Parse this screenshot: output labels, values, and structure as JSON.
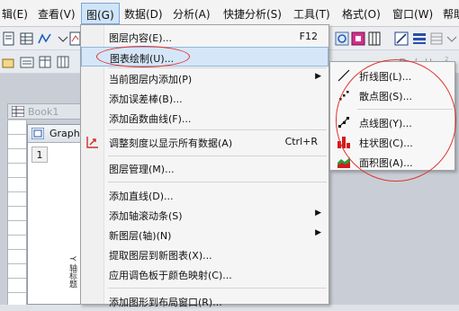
{
  "menubar": {
    "items": [
      "辑(E)",
      "查看(V)",
      "图(G)",
      "数据(D)",
      "分析(A)",
      "快捷分析(S)",
      "工具(T)",
      "格式(O)",
      "窗口(W)",
      "帮助"
    ]
  },
  "workspace": {
    "book_title": "Book1",
    "graph_title": "Graph",
    "layer_number": "1",
    "axis_label": "Y 轴标题"
  },
  "menu": {
    "items": [
      {
        "label": "图层内容(E)...",
        "shortcut": "F12"
      },
      {
        "label": "图表绘制(U)..."
      },
      {
        "label": "当前图层内添加(P)"
      },
      {
        "label": "添加误差棒(B)..."
      },
      {
        "label": "添加函数曲线(F)..."
      },
      {
        "label": "调整刻度以显示所有数据(A)",
        "shortcut": "Ctrl+R"
      },
      {
        "label": "图层管理(M)..."
      },
      {
        "label": "添加直线(D)..."
      },
      {
        "label": "添加轴滚动条(S)"
      },
      {
        "label": "新图层(轴)(N)"
      },
      {
        "label": "提取图层到新图表(X)..."
      },
      {
        "label": "应用调色板于颜色映射(C)..."
      },
      {
        "label": "添加图形到布局窗口(R)..."
      }
    ]
  },
  "submenu": {
    "items": [
      {
        "label": "折线图(L)...",
        "icon": "line-graph-icon"
      },
      {
        "label": "散点图(S)...",
        "icon": "scatter-graph-icon"
      },
      {
        "label": "点线图(Y)...",
        "icon": "line-symbol-graph-icon"
      },
      {
        "label": "柱状图(C)...",
        "icon": "column-graph-icon"
      },
      {
        "label": "面积图(A)...",
        "icon": "area-graph-icon"
      }
    ]
  },
  "colors": {
    "annotation": "#e0322f",
    "menu_highlight": "#d5e6f8",
    "accent_blue": "#1f5fbf"
  }
}
